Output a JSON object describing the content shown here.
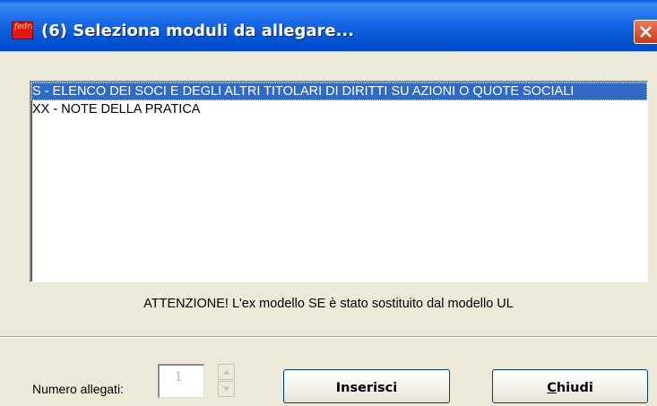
{
  "window": {
    "title": "(6) Seleziona moduli da allegare...",
    "icon_name": "app-logo-icon",
    "icon_text": "fedra"
  },
  "modules_list": {
    "items": [
      {
        "label": "S - ELENCO DEI SOCI E DEGLI ALTRI TITOLARI DI DIRITTI SU AZIONI O QUOTE SOCIALI",
        "selected": true
      },
      {
        "label": "XX - NOTE DELLA PRATICA",
        "selected": false
      }
    ]
  },
  "notice": "ATTENZIONE! L'ex modello SE è stato sostituito dal modello UL",
  "footer": {
    "count_label": "Numero allegati:",
    "count_value": "1",
    "insert_label": "Inserisci",
    "close_label_first": "C",
    "close_label_rest": "hiudi"
  },
  "colors": {
    "titlebar": "#0556d6",
    "selection": "#316ac5",
    "dialog_bg": "#ece9d8"
  }
}
